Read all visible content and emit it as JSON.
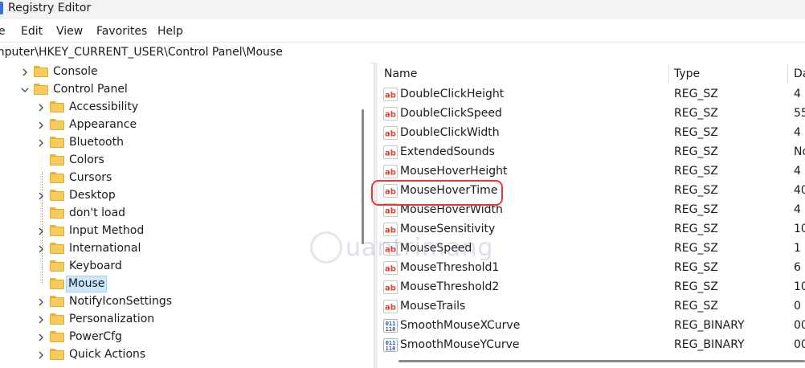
{
  "window": {
    "title": "Registry Editor"
  },
  "menu": [
    "e",
    "Edit",
    "View",
    "Favorites",
    "Help"
  ],
  "address": "mputer\\HKEY_CURRENT_USER\\Control Panel\\Mouse",
  "tree": {
    "nodes": [
      {
        "label": "Console",
        "expander": "collapsed"
      },
      {
        "label": "Control Panel",
        "expander": "expanded"
      },
      {
        "label": "Accessibility",
        "expander": "collapsed"
      },
      {
        "label": "Appearance",
        "expander": "collapsed"
      },
      {
        "label": "Bluetooth",
        "expander": "collapsed"
      },
      {
        "label": "Colors",
        "expander": "none"
      },
      {
        "label": "Cursors",
        "expander": "none"
      },
      {
        "label": "Desktop",
        "expander": "collapsed"
      },
      {
        "label": "don't load",
        "expander": "none"
      },
      {
        "label": "Input Method",
        "expander": "collapsed"
      },
      {
        "label": "International",
        "expander": "collapsed"
      },
      {
        "label": "Keyboard",
        "expander": "none"
      },
      {
        "label": "Mouse",
        "expander": "none",
        "selected": true
      },
      {
        "label": "NotifyIconSettings",
        "expander": "collapsed"
      },
      {
        "label": "Personalization",
        "expander": "collapsed"
      },
      {
        "label": "PowerCfg",
        "expander": "collapsed"
      },
      {
        "label": "Quick Actions",
        "expander": "collapsed"
      }
    ]
  },
  "list": {
    "columns": [
      "Name",
      "Type",
      "Da"
    ],
    "rows": [
      {
        "name": "DoubleClickHeight",
        "type": "REG_SZ",
        "data": "4",
        "icon": "string-value-icon"
      },
      {
        "name": "DoubleClickSpeed",
        "type": "REG_SZ",
        "data": "55",
        "icon": "string-value-icon"
      },
      {
        "name": "DoubleClickWidth",
        "type": "REG_SZ",
        "data": "4",
        "icon": "string-value-icon"
      },
      {
        "name": "ExtendedSounds",
        "type": "REG_SZ",
        "data": "No",
        "icon": "string-value-icon"
      },
      {
        "name": "MouseHoverHeight",
        "type": "REG_SZ",
        "data": "4",
        "icon": "string-value-icon"
      },
      {
        "name": "MouseHoverTime",
        "type": "REG_SZ",
        "data": "40",
        "icon": "string-value-icon",
        "highlighted": true
      },
      {
        "name": "MouseHoverWidth",
        "type": "REG_SZ",
        "data": "4",
        "icon": "string-value-icon"
      },
      {
        "name": "MouseSensitivity",
        "type": "REG_SZ",
        "data": "10",
        "icon": "string-value-icon"
      },
      {
        "name": "MouseSpeed",
        "type": "REG_SZ",
        "data": "1",
        "icon": "string-value-icon"
      },
      {
        "name": "MouseThreshold1",
        "type": "REG_SZ",
        "data": "6",
        "icon": "string-value-icon"
      },
      {
        "name": "MouseThreshold2",
        "type": "REG_SZ",
        "data": "10",
        "icon": "string-value-icon"
      },
      {
        "name": "MouseTrails",
        "type": "REG_SZ",
        "data": "0",
        "icon": "string-value-icon"
      },
      {
        "name": "SmoothMouseXCurve",
        "type": "REG_BINARY",
        "data": "00",
        "icon": "binary-value-icon"
      },
      {
        "name": "SmoothMouseYCurve",
        "type": "REG_BINARY",
        "data": "00",
        "icon": "binary-value-icon"
      }
    ]
  },
  "watermark": {
    "text": "uantrimang"
  },
  "colors": {
    "highlight_ring": "#e23b3b",
    "selection_bg": "#cce8ff",
    "folder": "#f6cd5c",
    "string_icon": "#d0453a",
    "binary_icon": "#2f57a8"
  }
}
